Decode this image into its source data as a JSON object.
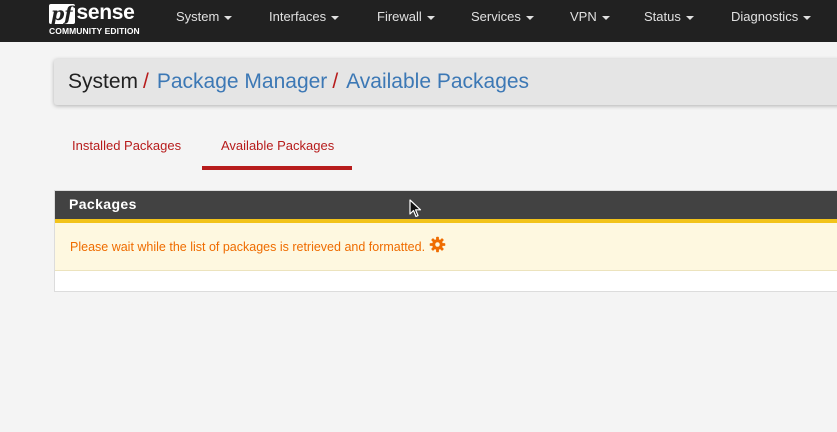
{
  "logo": {
    "pf": "pf",
    "sense": "sense",
    "edition": "COMMUNITY EDITION"
  },
  "nav": {
    "items": [
      {
        "label": "System"
      },
      {
        "label": "Interfaces"
      },
      {
        "label": "Firewall"
      },
      {
        "label": "Services"
      },
      {
        "label": "VPN"
      },
      {
        "label": "Status"
      },
      {
        "label": "Diagnostics"
      }
    ]
  },
  "breadcrumb": {
    "items": [
      "System",
      "Package Manager",
      "Available Packages"
    ],
    "separator": "/"
  },
  "tabs": {
    "items": [
      {
        "label": "Installed Packages",
        "active": false
      },
      {
        "label": "Available Packages",
        "active": true
      }
    ]
  },
  "panel": {
    "title": "Packages",
    "message": "Please wait while the list of packages is retrieved and formatted.",
    "message_icon": "gear-icon"
  },
  "colors": {
    "topbar": "#212121",
    "accent_red": "#b71c1c",
    "link_blue": "#3c78b5",
    "panel_heading": "#424242",
    "heading_stripe": "#f2c31a",
    "alert_text": "#ef6c00",
    "alert_background": "#fef8e0"
  }
}
